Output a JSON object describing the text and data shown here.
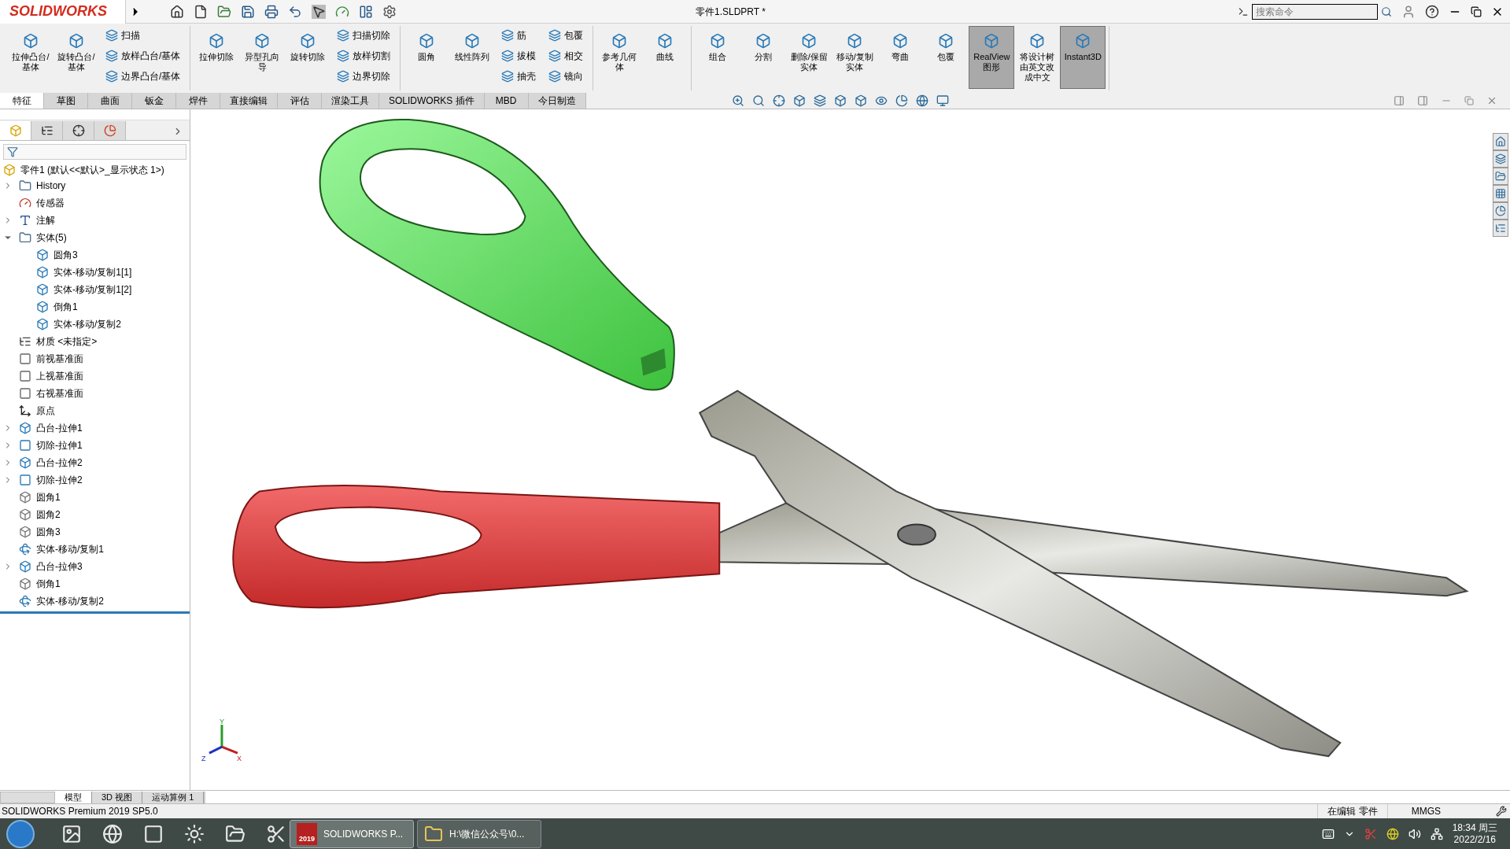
{
  "title_bar": {
    "logo": "SOLIDWORKS",
    "document_title": "零件1.SLDPRT *",
    "search": {
      "placeholder": "搜索命令"
    }
  },
  "ribbon": [
    {
      "items": [
        {
          "kind": "large",
          "label": "拉伸凸台/基体",
          "pressed": false
        },
        {
          "kind": "large",
          "label": "旋转凸台/基体",
          "pressed": false
        },
        {
          "kind": "stack",
          "items": [
            "扫描",
            "放样凸台/基体",
            "边界凸台/基体"
          ]
        }
      ]
    },
    {
      "items": [
        {
          "kind": "large",
          "label": "拉伸切除",
          "pressed": false
        },
        {
          "kind": "large",
          "label": "异型孔向导",
          "pressed": false
        },
        {
          "kind": "large",
          "label": "旋转切除",
          "pressed": false
        },
        {
          "kind": "stack",
          "items": [
            "扫描切除",
            "放样切割",
            "边界切除"
          ]
        }
      ]
    },
    {
      "items": [
        {
          "kind": "large",
          "label": "圆角",
          "pressed": false
        },
        {
          "kind": "large",
          "label": "线性阵列",
          "pressed": false
        },
        {
          "kind": "stack",
          "items": [
            "筋",
            "拔模",
            "抽壳"
          ]
        },
        {
          "kind": "stack",
          "items": [
            "包覆",
            "相交",
            "镜向"
          ]
        }
      ]
    },
    {
      "items": [
        {
          "kind": "large",
          "label": "参考几何体",
          "pressed": false
        },
        {
          "kind": "large",
          "label": "曲线",
          "pressed": false
        }
      ]
    },
    {
      "items": [
        {
          "kind": "large",
          "label": "组合",
          "pressed": false
        },
        {
          "kind": "large",
          "label": "分割",
          "pressed": false
        },
        {
          "kind": "large",
          "label": "删除/保留实体",
          "pressed": false
        },
        {
          "kind": "large",
          "label": "移动/复制实体",
          "pressed": false
        },
        {
          "kind": "large",
          "label": "弯曲",
          "pressed": false
        },
        {
          "kind": "large",
          "label": "包覆",
          "pressed": false
        },
        {
          "kind": "large",
          "label": "RealView 图形",
          "pressed": true
        },
        {
          "kind": "large",
          "label": "将设计树由英文改成中文",
          "pressed": false
        },
        {
          "kind": "large",
          "label": "Instant3D",
          "pressed": true
        }
      ]
    }
  ],
  "command_tabs": [
    {
      "label": "特征",
      "selected": true
    },
    {
      "label": "草图",
      "selected": false
    },
    {
      "label": "曲面",
      "selected": false
    },
    {
      "label": "钣金",
      "selected": false
    },
    {
      "label": "焊件",
      "selected": false
    },
    {
      "label": "直接编辑",
      "selected": false
    },
    {
      "label": "评估",
      "selected": false
    },
    {
      "label": "渲染工具",
      "selected": false
    },
    {
      "label": "SOLIDWORKS 插件",
      "selected": false
    },
    {
      "label": "MBD",
      "selected": false
    },
    {
      "label": "今日制造",
      "selected": false
    }
  ],
  "feature_tree": {
    "root": "零件1  (默认<<默认>_显示状态 1>)",
    "items": [
      {
        "kind": "folder",
        "label": "History",
        "expanded": false
      },
      {
        "kind": "sensor",
        "label": "传感器"
      },
      {
        "kind": "annotation",
        "label": "注解",
        "expanded": false
      },
      {
        "kind": "folder",
        "label": "实体(5)",
        "expanded": true,
        "children": [
          {
            "kind": "body",
            "label": "圆角3"
          },
          {
            "kind": "body",
            "label": "实体-移动/复制1[1]"
          },
          {
            "kind": "body",
            "label": "实体-移动/复制1[2]"
          },
          {
            "kind": "body",
            "label": "倒角1"
          },
          {
            "kind": "body",
            "label": "实体-移动/复制2"
          }
        ]
      },
      {
        "kind": "material",
        "label": "材质 <未指定>"
      },
      {
        "kind": "plane",
        "label": "前视基准面"
      },
      {
        "kind": "plane",
        "label": "上视基准面"
      },
      {
        "kind": "plane",
        "label": "右视基准面"
      },
      {
        "kind": "origin",
        "label": "原点"
      },
      {
        "kind": "boss",
        "label": "凸台-拉伸1",
        "expanded": false
      },
      {
        "kind": "cut",
        "label": "切除-拉伸1",
        "expanded": false
      },
      {
        "kind": "boss",
        "label": "凸台-拉伸2",
        "expanded": false
      },
      {
        "kind": "cut",
        "label": "切除-拉伸2",
        "expanded": false
      },
      {
        "kind": "fillet",
        "label": "圆角1"
      },
      {
        "kind": "fillet",
        "label": "圆角2"
      },
      {
        "kind": "fillet",
        "label": "圆角3"
      },
      {
        "kind": "move",
        "label": "实体-移动/复制1"
      },
      {
        "kind": "boss",
        "label": "凸台-拉伸3",
        "expanded": false
      },
      {
        "kind": "fillet",
        "label": "倒角1"
      },
      {
        "kind": "move",
        "label": "实体-移动/复制2"
      }
    ]
  },
  "triad": {
    "labels": [
      "Y",
      "Z",
      "X"
    ]
  },
  "panel_tabs": [
    {
      "selected": true
    },
    {
      "selected": false
    },
    {
      "selected": false
    },
    {
      "selected": false
    }
  ],
  "bottom_tabs": [
    {
      "label": "模型",
      "selected": true
    },
    {
      "label": "3D 视图",
      "selected": false
    },
    {
      "label": "运动算例 1",
      "selected": false
    }
  ],
  "status_bar": {
    "product": "SOLIDWORKS Premium 2019 SP5.0",
    "mode": "在编辑 零件",
    "units": "MMGS"
  },
  "taskbar": {
    "windows": [
      {
        "label": "SOLIDWORKS P...",
        "badge": "2019",
        "selected": true
      },
      {
        "label": "H:\\微信公众号\\0...",
        "selected": false
      }
    ],
    "time": "18:34 周三",
    "date": "2022/2/16"
  }
}
